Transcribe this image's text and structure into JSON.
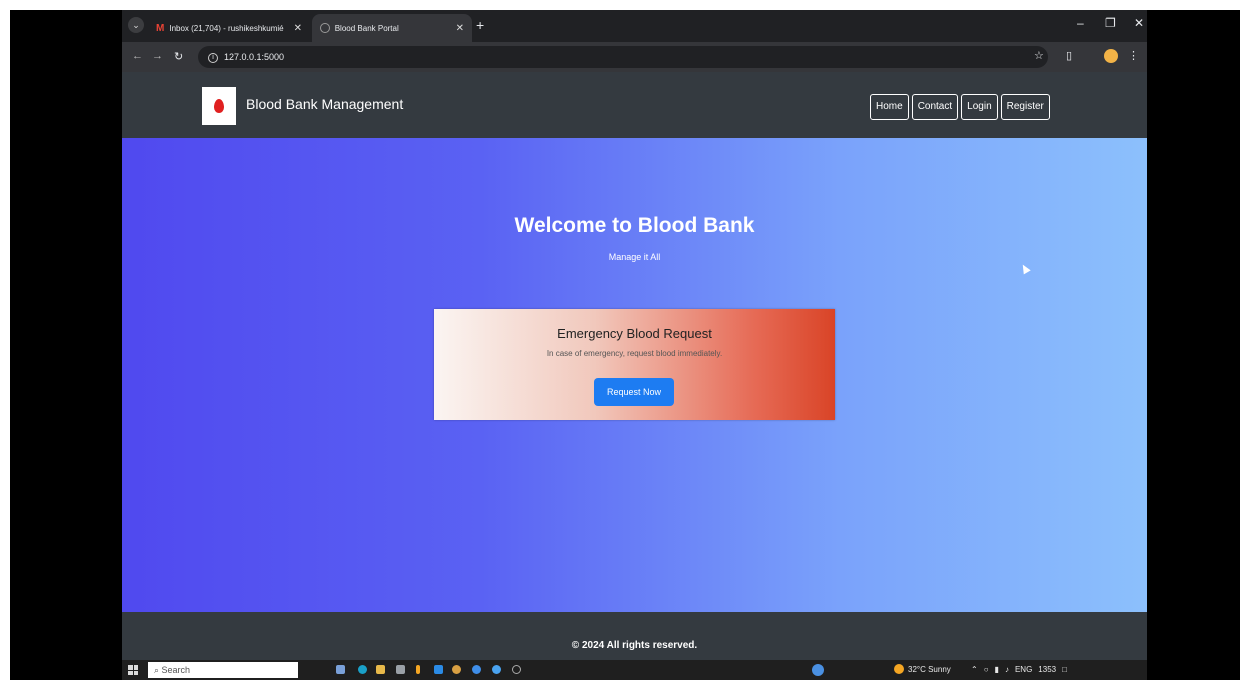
{
  "browser": {
    "tabs": [
      {
        "title": "Inbox (21,704) - rushikeshkumié"
      },
      {
        "title": "Blood Bank Portal"
      }
    ],
    "url": "127.0.0.1:5000"
  },
  "navbar": {
    "brand": "Blood Bank Management",
    "links": [
      "Home",
      "Contact",
      "Login",
      "Register"
    ]
  },
  "hero": {
    "title": "Welcome to Blood Bank",
    "tagline": "Manage it All"
  },
  "emergency_card": {
    "title": "Emergency Blood Request",
    "text": "In case of emergency, request blood immediately.",
    "button": "Request Now"
  },
  "footer": {
    "text": "© 2024 All rights reserved."
  },
  "taskbar": {
    "search_placeholder": "Search",
    "weather": "32°C Sunny",
    "language": "ENG",
    "time": "1353"
  },
  "colors": {
    "navbar_bg": "#343a40",
    "hero_gradient_start": "#5049ef",
    "hero_gradient_end": "#8cc0fc",
    "card_gradient_end": "#d94427",
    "button_bg": "#1d7cf2"
  }
}
